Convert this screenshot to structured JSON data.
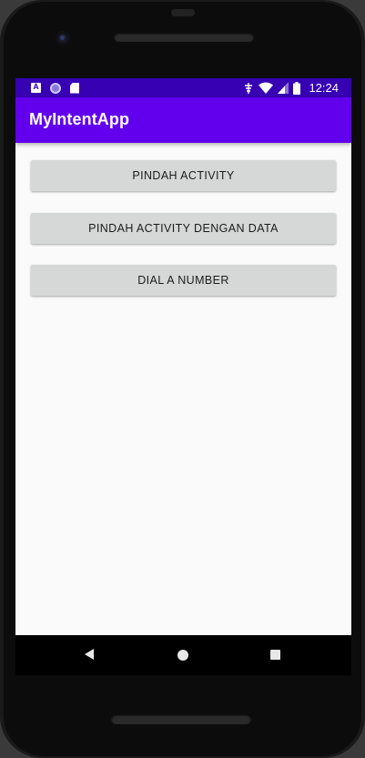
{
  "status_bar": {
    "time": "12:24",
    "notification_icons": [
      "android-a-icon",
      "sync-circle-icon",
      "sd-card-icon"
    ],
    "system_icons": [
      "data-saver-icon",
      "wifi-icon",
      "cell-signal-icon",
      "battery-icon"
    ],
    "color": "#3700b3"
  },
  "app_bar": {
    "title": "MyIntentApp",
    "color": "#6200ee"
  },
  "buttons": [
    {
      "label": "PINDAH ACTIVITY"
    },
    {
      "label": "PINDAH ACTIVITY DENGAN DATA"
    },
    {
      "label": "DIAL A NUMBER"
    }
  ],
  "nav_bar": {
    "icons": [
      "back-icon",
      "home-icon",
      "recent-apps-icon"
    ]
  }
}
